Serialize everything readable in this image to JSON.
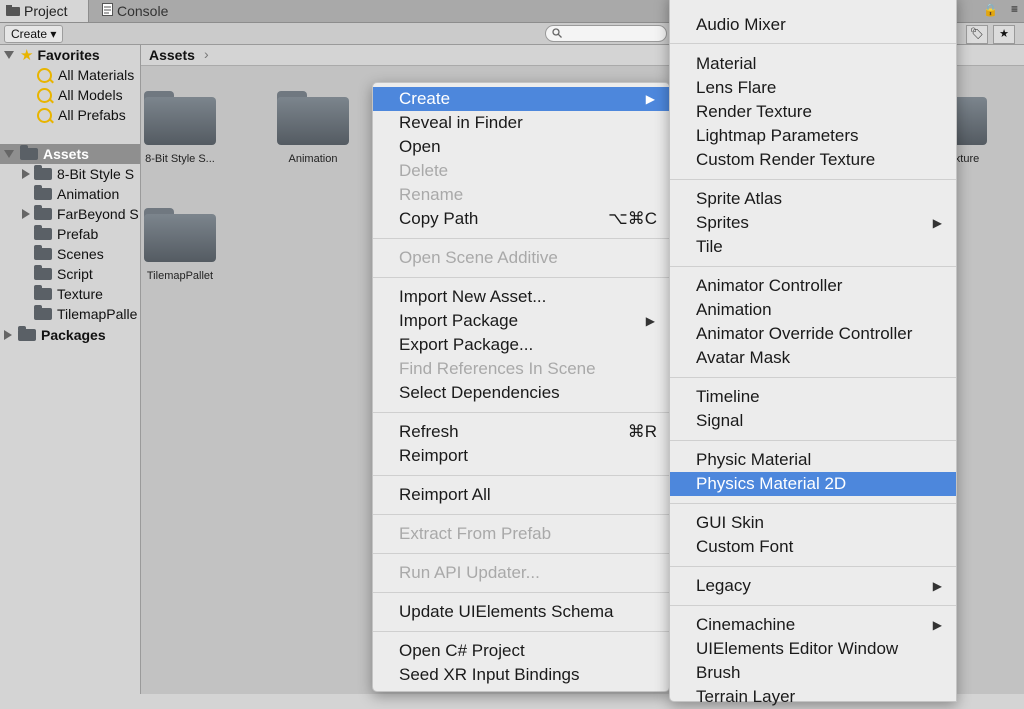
{
  "tabs": {
    "project": "Project",
    "console": "Console"
  },
  "toolbar": {
    "create": "Create ▾"
  },
  "tree": {
    "favorites": "Favorites",
    "fav_items": [
      "All Materials",
      "All Models",
      "All Prefabs"
    ],
    "assets": "Assets",
    "asset_items": [
      "8-Bit Style S",
      "Animation",
      "FarBeyond S",
      "Prefab",
      "Scenes",
      "Script",
      "Texture",
      "TilemapPalle"
    ],
    "packages": "Packages"
  },
  "breadcrumb": {
    "root": "Assets",
    "chevron": "›"
  },
  "assets": [
    "8-Bit Style S...",
    "Animation",
    "TilemapPallet"
  ],
  "partial_asset": "xture",
  "context_menu": {
    "create": "Create",
    "reveal": "Reveal in Finder",
    "open": "Open",
    "delete": "Delete",
    "rename": "Rename",
    "copy_path": "Copy Path",
    "copy_path_shortcut": "⌥⌘C",
    "open_scene_additive": "Open Scene Additive",
    "import_new_asset": "Import New Asset...",
    "import_package": "Import Package",
    "export_package": "Export Package...",
    "find_references": "Find References In Scene",
    "select_dependencies": "Select Dependencies",
    "refresh": "Refresh",
    "refresh_shortcut": "⌘R",
    "reimport": "Reimport",
    "reimport_all": "Reimport All",
    "extract_from_prefab": "Extract From Prefab",
    "run_api_updater": "Run API Updater...",
    "update_uielements": "Update UIElements Schema",
    "open_csharp": "Open C# Project",
    "seed_xr": "Seed XR Input Bindings",
    "submenu_arrow": "▶"
  },
  "create_submenu": {
    "audio_mixer": "Audio Mixer",
    "material": "Material",
    "lens_flare": "Lens Flare",
    "render_texture": "Render Texture",
    "lightmap_parameters": "Lightmap Parameters",
    "custom_render_texture": "Custom Render Texture",
    "sprite_atlas": "Sprite Atlas",
    "sprites": "Sprites",
    "tile": "Tile",
    "animator_controller": "Animator Controller",
    "animation": "Animation",
    "animator_override": "Animator Override Controller",
    "avatar_mask": "Avatar Mask",
    "timeline": "Timeline",
    "signal": "Signal",
    "physic_material": "Physic Material",
    "physics_material_2d": "Physics Material 2D",
    "gui_skin": "GUI Skin",
    "custom_font": "Custom Font",
    "legacy": "Legacy",
    "cinemachine": "Cinemachine",
    "uielements_window": "UIElements Editor Window",
    "brush": "Brush",
    "terrain_layer": "Terrain Layer"
  },
  "colors": {
    "highlight": "#4d87dc",
    "menu_bg": "#ececec"
  }
}
